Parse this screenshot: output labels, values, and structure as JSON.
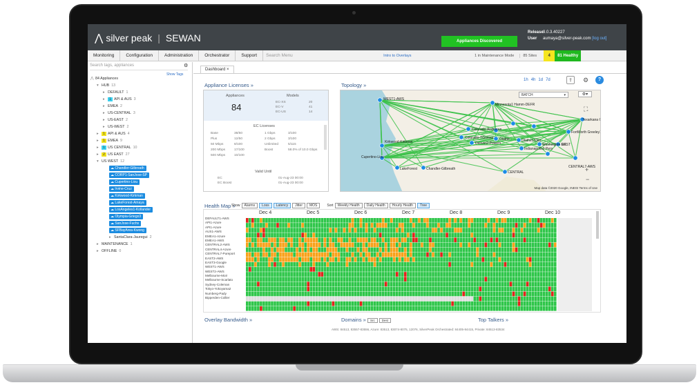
{
  "header": {
    "brand": "silver peak",
    "tenant": "SEWAN",
    "status_button": "Appliances Discovered",
    "release_label": "Release",
    "release_value": "9.0.3.40227",
    "user_label": "User",
    "user_value": "aumaya@silver-peak.com",
    "logout": "[log out]"
  },
  "menu": {
    "items": [
      "Monitoring",
      "Configuration",
      "Administration",
      "Orchestrator",
      "Support"
    ],
    "search_placeholder": "Search Menu",
    "intro_link": "Intro to Overlays",
    "maintenance": "1 in Maintenance Mode",
    "sites": "85 Sites",
    "warn_count": "4",
    "healthy": "81 Healthy"
  },
  "sidebar": {
    "search_placeholder": "Search tags, appliances",
    "show_tags": "Show Tags",
    "tree": [
      {
        "label": "84 Appliances",
        "count": "",
        "indent": 0,
        "type": "root"
      },
      {
        "label": "HUB",
        "count": "13",
        "indent": 1,
        "type": "group"
      },
      {
        "label": "DEFAULT",
        "count": "1",
        "indent": 2,
        "type": "item"
      },
      {
        "label": "API & AUS",
        "count": "3",
        "indent": 2,
        "type": "item",
        "badge": "c",
        "badge_text": "1"
      },
      {
        "label": "EMEA",
        "count": "2",
        "indent": 2,
        "type": "item"
      },
      {
        "label": "US-CENTRAL",
        "count": "3",
        "indent": 2,
        "type": "item"
      },
      {
        "label": "US-EAST",
        "count": "2",
        "indent": 2,
        "type": "item"
      },
      {
        "label": "US-WEST",
        "count": "2",
        "indent": 2,
        "type": "item"
      },
      {
        "label": "API & AUS",
        "count": "4",
        "indent": 1,
        "type": "item",
        "badge": "y",
        "badge_text": "1"
      },
      {
        "label": "EMEA",
        "count": "9",
        "indent": 1,
        "type": "item",
        "badge": "y",
        "badge_text": "1"
      },
      {
        "label": "US CENTRAL",
        "count": "10",
        "indent": 1,
        "type": "item",
        "badge": "c",
        "badge_text": "1"
      },
      {
        "label": "US EAST",
        "count": "27",
        "indent": 1,
        "type": "item",
        "badge": "y",
        "badge_text": "2"
      },
      {
        "label": "US WEST",
        "count": "12",
        "indent": 1,
        "type": "group"
      },
      {
        "label": "Chandler-Gilbreath",
        "count": "",
        "indent": 3,
        "type": "app"
      },
      {
        "label": "CORP1-SanJose-SP",
        "count": "",
        "indent": 3,
        "type": "app"
      },
      {
        "label": "Cupertino-Liou",
        "count": "",
        "indent": 3,
        "type": "app"
      },
      {
        "label": "Irvine-Cruz",
        "count": "",
        "indent": 3,
        "type": "app"
      },
      {
        "label": "Kirkwood-Kirkman",
        "count": "",
        "indent": 3,
        "type": "app"
      },
      {
        "label": "LakeForest-Amaya",
        "count": "",
        "indent": 3,
        "type": "app"
      },
      {
        "label": "LosAngeles1-Kollander",
        "count": "",
        "indent": 3,
        "type": "app"
      },
      {
        "label": "Olympia-Griego3",
        "count": "",
        "indent": 3,
        "type": "app"
      },
      {
        "label": "SanJose-Fuchs",
        "count": "",
        "indent": 3,
        "type": "app"
      },
      {
        "label": "SFBayArea-Kwong",
        "count": "",
        "indent": 3,
        "type": "app"
      },
      {
        "label": "SantaClara-Jauregui",
        "count": "2",
        "indent": 3,
        "type": "item"
      },
      {
        "label": "MAINTENANCE",
        "count": "1",
        "indent": 1,
        "type": "item"
      },
      {
        "label": "OFFLINE",
        "count": "0",
        "indent": 1,
        "type": "item"
      }
    ]
  },
  "dashboard": {
    "tab": "Dashboard",
    "time_ranges": [
      "1h",
      "4h",
      "1d",
      "7d"
    ],
    "licenses": {
      "title": "Appliance Licenses",
      "appliances_label": "Appliances",
      "appliances_value": "84",
      "models_label": "Models",
      "models": [
        [
          "EC-XS",
          "20"
        ],
        [
          "EC-V",
          "41"
        ],
        [
          "EC-US",
          "14"
        ]
      ],
      "ec_licenses_label": "EC Licenses",
      "rows_left": [
        [
          "Base",
          "38/50"
        ],
        [
          "Plus",
          "12/50"
        ],
        [
          "50 Mbps",
          "8/100"
        ],
        [
          "200 Mbps",
          "17/100"
        ],
        [
          "500 Mbps",
          "10/100"
        ]
      ],
      "rows_right": [
        [
          "1 Gbps",
          "3/100"
        ],
        [
          "2 Gbps",
          "3/100"
        ],
        [
          "Unlimited",
          "5/115"
        ],
        [
          "Boost",
          "58.0% of 10.0 Gbps"
        ]
      ],
      "valid_label": "Valid Until",
      "valid_rows": [
        [
          "EC",
          "01-Aug-23 00:00"
        ],
        [
          "EC Boost",
          "01-Aug-23 00:00"
        ]
      ]
    },
    "topology": {
      "title": "Topology",
      "select": "BATCH",
      "footer": "Map data ©2020 Google, INEGI   Terms of Use",
      "labels": [
        "WEST1-AWS",
        "Kirkwood-Kirkman",
        "Cupertino-Liou",
        "LakeForest",
        "Chandler-Gilbreath",
        "Minnesota1 Hamm-DEFR",
        "Colorado-Anderson",
        "Colorado-TGroose",
        "Denver2-Powers",
        "Olathe",
        "Olathe1-Dan",
        "Indianapolis2 Pers",
        "Washington DC",
        "EAST",
        "FortWorth Greeley1",
        "Texarkana Cohen",
        "CENTRAL",
        "CENTRAL7-AWS"
      ]
    },
    "health": {
      "title": "Health Map",
      "show_label": "Show",
      "filters": [
        "Alarms",
        "Loss",
        "Latency",
        "Jitter",
        "MOS"
      ],
      "sort_label": "Sort",
      "sorts": [
        "Weekly Health",
        "Daily Health",
        "Hourly Health",
        "Tree"
      ],
      "days": [
        "Dec 4",
        "Dec 5",
        "Dec 6",
        "Dec 7",
        "Dec 8",
        "Dec 9",
        "Dec 10"
      ],
      "rows": [
        "DEFAULT1-AWS",
        "API1-Azure",
        "API1-Azure",
        "AUS1-AWS",
        "EMEA1-Azure",
        "EMEA1-AWS",
        "CENTRAL2-AWS",
        "CENTRAL4-Azure",
        "CENTRAL7-Pureport",
        "EAST2-AWS",
        "EAST3-Google",
        "WEST1-AWS",
        "WEST2-AWS",
        "Melbourne-Moir",
        "Melbourne-Scarlato",
        "Sydney-Coleman",
        "Tokyo-Yokoyama2",
        "Numberg-Pady",
        "Bipperden-Collier"
      ]
    },
    "bottom": {
      "overlay": "Overlay Bandwidth",
      "domains": "Domains",
      "domain_btns": [
        "Src",
        "Dest"
      ],
      "top_talkers": "Top Talkers",
      "domain_line": "AWS: 84513, 83557-83556, Azure: 83513, 83074-8075, 12076, SilverPeak Orchestrated: 84405-84415, Private: 84513-83534"
    }
  },
  "colors": {
    "healthy": "#2fc64a",
    "warning": "#f7a21b",
    "critical": "#e2231a",
    "nodata": "#dedede",
    "accent": "#2a6cc4"
  }
}
